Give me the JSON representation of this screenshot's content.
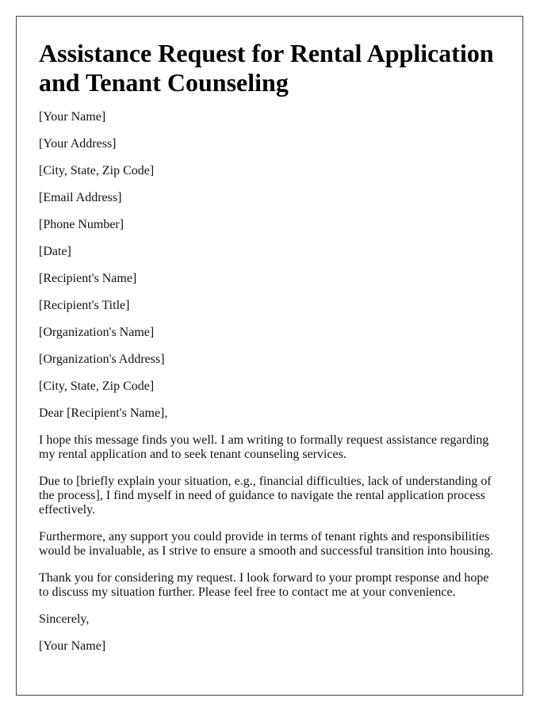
{
  "title": "Assistance Request for Rental Application and Tenant Counseling",
  "sender": [
    "[Your Name]",
    "[Your Address]",
    "[City, State, Zip Code]",
    "[Email Address]",
    "[Phone Number]"
  ],
  "date": "[Date]",
  "recipient": [
    "[Recipient's Name]",
    "[Recipient's Title]",
    "[Organization's Name]",
    "[Organization's Address]",
    "[City, State, Zip Code]"
  ],
  "salutation": "Dear [Recipient's Name],",
  "body": [
    "I hope this message finds you well. I am writing to formally request assistance regarding my rental application and to seek tenant counseling services.",
    "Due to [briefly explain your situation, e.g., financial difficulties, lack of understanding of the process], I find myself in need of guidance to navigate the rental application process effectively.",
    "Furthermore, any support you could provide in terms of tenant rights and responsibilities would be invaluable, as I strive to ensure a smooth and successful transition into housing.",
    "Thank you for considering my request. I look forward to your prompt response and hope to discuss my situation further. Please feel free to contact me at your convenience."
  ],
  "closing": "Sincerely,",
  "signature": "[Your Name]"
}
